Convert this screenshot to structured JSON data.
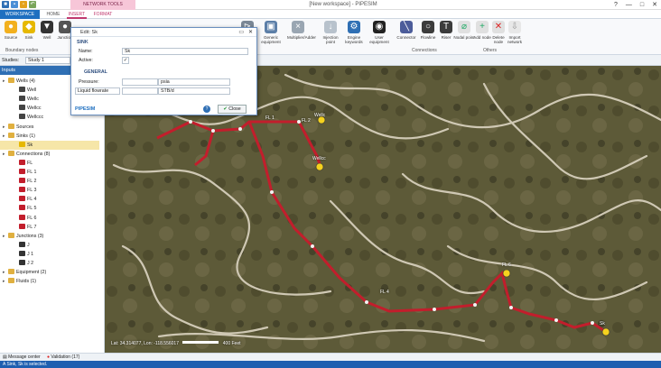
{
  "title_bar": {
    "window_title": "[New workspace] - PIPESIM",
    "context_tab": "NETWORK TOOLS",
    "window_buttons": [
      "?",
      "—",
      "□",
      "✕"
    ]
  },
  "tabs": [
    "WORKSPACE",
    "HOME",
    "INSERT",
    "FORMAT"
  ],
  "ribbon": {
    "left_buttons": [
      "Source",
      "Sink",
      "Well",
      "Junction"
    ],
    "right_buttons": [
      "Expander",
      "Generic equipment",
      "Multiplier/Adder",
      "Injection point",
      "Engine keywords",
      "User equipment",
      "Connector",
      "Flowline",
      "Riser",
      "Nodal point",
      "Add node",
      "Delete node",
      "Import network"
    ],
    "groups": [
      "Boundary nodes",
      "Connections",
      "Others"
    ],
    "colors": {
      "accent": "#1e6fc0",
      "context": "#c0396e"
    }
  },
  "study_bar": {
    "label": "Studies:",
    "value": "Study 1"
  },
  "sidebar": {
    "header": "Inputs",
    "tree": [
      {
        "label": "Wells (4)",
        "level": 0,
        "icon": "folder-icon"
      },
      {
        "label": "Well",
        "level": 1,
        "icon": "well-icon"
      },
      {
        "label": "Wellc",
        "level": 1,
        "icon": "well-icon"
      },
      {
        "label": "Wellcc",
        "level": 1,
        "icon": "well-icon"
      },
      {
        "label": "Wellccc",
        "level": 1,
        "icon": "well-icon"
      },
      {
        "label": "Sources",
        "level": 0,
        "icon": "folder-icon"
      },
      {
        "label": "Sinks (1)",
        "level": 0,
        "icon": "folder-icon"
      },
      {
        "label": "Sk",
        "level": 1,
        "icon": "sink-icon",
        "selected": true
      },
      {
        "label": "Connections (8)",
        "level": 0,
        "icon": "folder-icon"
      },
      {
        "label": "FL",
        "level": 1,
        "icon": "flowline-icon"
      },
      {
        "label": "FL 1",
        "level": 1,
        "icon": "flowline-icon"
      },
      {
        "label": "FL 2",
        "level": 1,
        "icon": "flowline-icon"
      },
      {
        "label": "FL 3",
        "level": 1,
        "icon": "flowline-icon"
      },
      {
        "label": "FL 4",
        "level": 1,
        "icon": "flowline-icon"
      },
      {
        "label": "FL 5",
        "level": 1,
        "icon": "flowline-icon"
      },
      {
        "label": "FL 6",
        "level": 1,
        "icon": "flowline-icon"
      },
      {
        "label": "FL 7",
        "level": 1,
        "icon": "flowline-icon"
      },
      {
        "label": "Junctions (3)",
        "level": 0,
        "icon": "folder-icon"
      },
      {
        "label": "J",
        "level": 1,
        "icon": "junction-icon"
      },
      {
        "label": "J 1",
        "level": 1,
        "icon": "junction-icon"
      },
      {
        "label": "J 2",
        "level": 1,
        "icon": "junction-icon"
      },
      {
        "label": "Equipment (2)",
        "level": 0,
        "icon": "folder-icon"
      },
      {
        "label": "Fluids (1)",
        "level": 0,
        "icon": "folder-icon"
      }
    ]
  },
  "dialog": {
    "title": "Edit: Sk",
    "section_sink": "SINK",
    "name_label": "Name:",
    "name_value": "Sk",
    "active_label": "Active:",
    "active_value": "✓",
    "section_general": "GENERAL",
    "pressure_label": "Pressure:",
    "pressure_value": "",
    "pressure_unit": "psia",
    "liquid_label": "Liquid flowrate",
    "liquid_value": "",
    "liquid_unit": "STB/d",
    "brand": "PIPESIM",
    "close_label": "Close"
  },
  "map": {
    "labels": [
      "FL 1",
      "FL 2",
      "Wellc",
      "Wellcc",
      "FL 4",
      "FL 6",
      "Sk"
    ],
    "coord_text": "Lat: 34.314077, Lon: -118.556017",
    "scale_text": "400 Feet"
  },
  "bottom_tabs": [
    "Message center",
    "Validation (17)"
  ],
  "status": "A Sink, Sk is selected."
}
